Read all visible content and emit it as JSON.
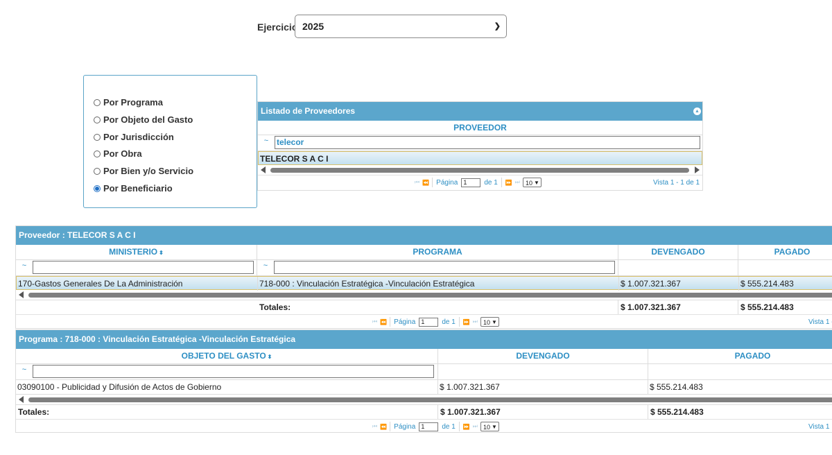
{
  "ejercicio": {
    "label": "Ejercicio:",
    "value": "2025"
  },
  "radios": [
    {
      "label": "Por Programa",
      "checked": false
    },
    {
      "label": "Por Objeto del Gasto",
      "checked": false
    },
    {
      "label": "Por Jurisdicción",
      "checked": false
    },
    {
      "label": "Por Obra",
      "checked": false
    },
    {
      "label": "Por Bien y/o Servicio",
      "checked": false
    },
    {
      "label": "Por Beneficiario",
      "checked": true
    }
  ],
  "proveedores": {
    "caption": "Listado de Proveedores",
    "header": "PROVEEDOR",
    "filter_value": "telecor",
    "row": "TELECOR S A C I",
    "pager": {
      "page_label": "Página",
      "page": "1",
      "of": "de 1",
      "rows": "10",
      "view": "Vista 1 - 1 de 1"
    }
  },
  "proveedor_grid": {
    "caption": "Proveedor : TELECOR S A C I",
    "headers": {
      "ministerio": "MINISTERIO",
      "programa": "PROGRAMA",
      "devengado": "DEVENGADO",
      "pagado": "PAGADO"
    },
    "row": {
      "ministerio": "170-Gastos Generales De La Administración",
      "programa": "718-000 : Vinculación Estratégica -Vinculación Estratégica",
      "devengado": "$ 1.007.321.367",
      "pagado": "$ 555.214.483"
    },
    "totals": {
      "label": "Totales:",
      "devengado": "$ 1.007.321.367",
      "pagado": "$ 555.214.483"
    },
    "pager": {
      "page_label": "Página",
      "page": "1",
      "of": "de 1",
      "rows": "10",
      "view": "Vista 1 -"
    }
  },
  "programa_grid": {
    "caption": "Programa : 718-000 : Vinculación Estratégica -Vinculación Estratégica",
    "headers": {
      "objeto": "OBJETO DEL GASTO",
      "devengado": "DEVENGADO",
      "pagado": "PAGADO"
    },
    "row": {
      "objeto": "03090100 - Publicidad y Difusión de Actos de Gobierno",
      "devengado": "$ 1.007.321.367",
      "pagado": "$ 555.214.483"
    },
    "totals": {
      "label": "Totales:",
      "devengado": "$ 1.007.321.367",
      "pagado": "$ 555.214.483"
    },
    "pager": {
      "page_label": "Página",
      "page": "1",
      "of": "de 1",
      "rows": "10",
      "view": "Vista 1"
    }
  },
  "icons": {
    "tilde": "~",
    "first": "⏮",
    "prev": "⏪",
    "next": "⏩",
    "last": "⏭"
  }
}
